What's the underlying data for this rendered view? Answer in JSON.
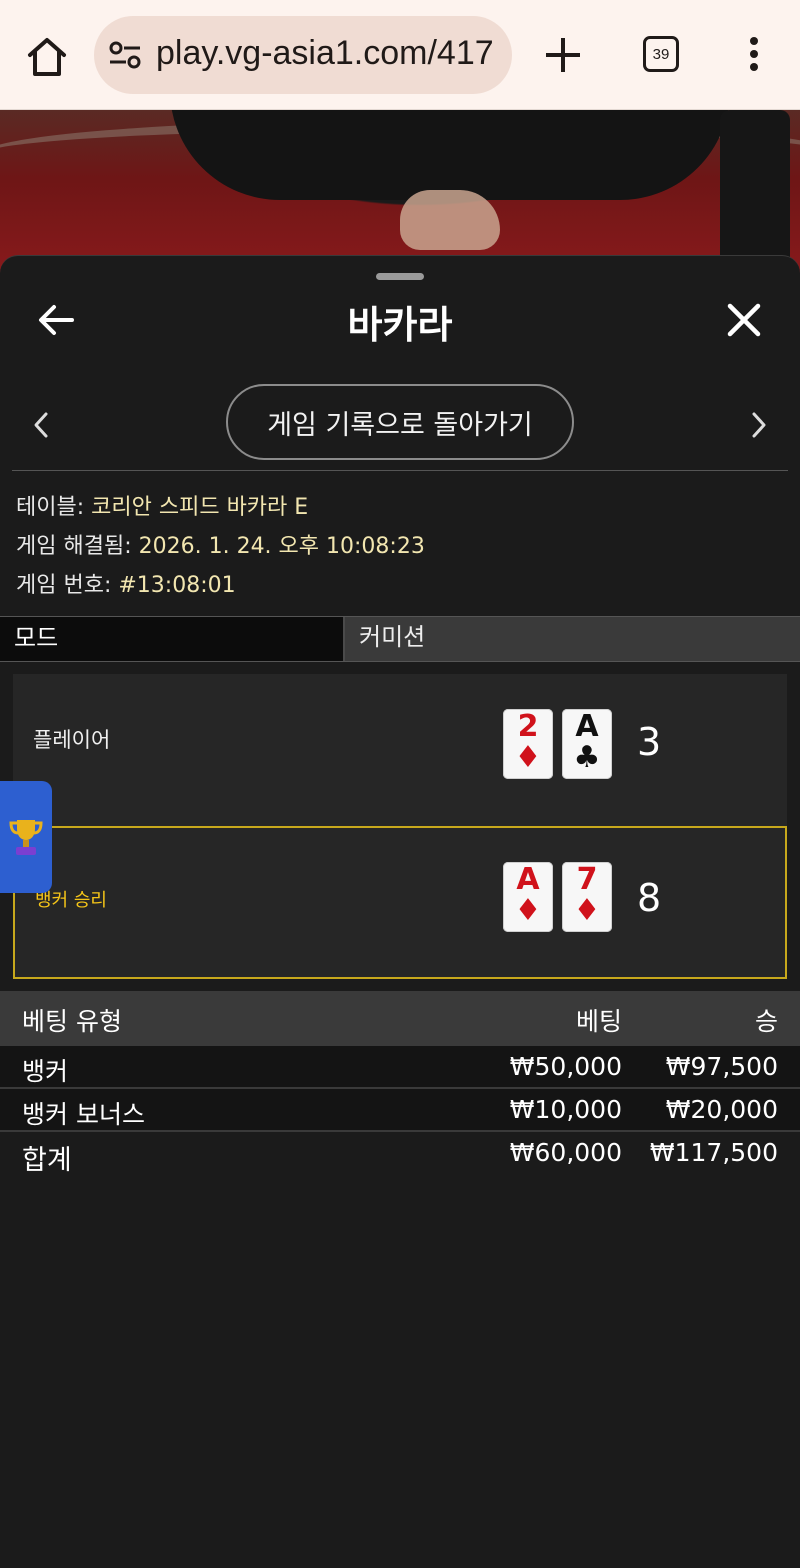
{
  "browser": {
    "url": "play.vg-asia1.com/417",
    "tab_count": "39"
  },
  "sheet": {
    "title": "바카라",
    "back_to_history": "게임 기록으로 돌아가기"
  },
  "info": {
    "table_label": "테이블:",
    "table_value": "코리안 스피드 바카라 E",
    "settled_label": "게임 해결됨:",
    "settled_value": "2026. 1. 24. 오후 10:08:23",
    "game_no_label": "게임 번호:",
    "game_no_value": "#13:08:01"
  },
  "mode": {
    "left": "모드",
    "right": "커미션"
  },
  "hands": {
    "player": {
      "label": "플레이어",
      "score": "3",
      "cards": [
        {
          "rank": "2",
          "suit": "♦",
          "color": "red"
        },
        {
          "rank": "A",
          "suit": "♣",
          "color": "black"
        }
      ]
    },
    "banker": {
      "label": "뱅커 승리",
      "score": "8",
      "cards": [
        {
          "rank": "A",
          "suit": "♦",
          "color": "red"
        },
        {
          "rank": "7",
          "suit": "♦",
          "color": "red"
        }
      ]
    }
  },
  "bets": {
    "headers": {
      "type": "베팅 유형",
      "bet": "베팅",
      "win": "승"
    },
    "rows": [
      {
        "type": "뱅커",
        "bet": "₩50,000",
        "win": "₩97,500"
      },
      {
        "type": "뱅커 보너스",
        "bet": "₩10,000",
        "win": "₩20,000"
      }
    ],
    "total": {
      "type": "합계",
      "bet": "₩60,000",
      "win": "₩117,500"
    }
  },
  "icons": {
    "home": "home-icon",
    "site_settings": "tune-icon",
    "new_tab": "plus-icon",
    "menu": "more-vert-icon",
    "back": "arrow-left-icon",
    "close": "close-icon",
    "prev": "chevron-left-icon",
    "next": "chevron-right-icon",
    "trophy": "trophy-icon"
  },
  "colors": {
    "sheet_bg": "#1b1b1b",
    "winner_border": "#c7a81c",
    "winner_label": "#f5c518",
    "info_value": "#f2e6b0",
    "card_red": "#d0121b",
    "float_tab": "#2d5fd0"
  }
}
